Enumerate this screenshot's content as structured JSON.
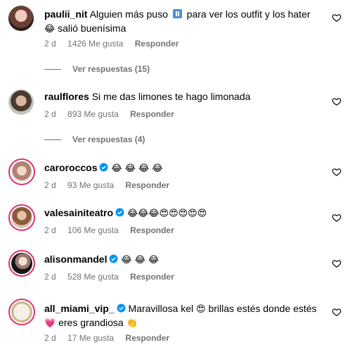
{
  "comments": [
    {
      "username": "paulii_nit",
      "text1": "Alguien más puso",
      "text1b": "para ver los outfit y los hater",
      "text2": "salió buenísima",
      "text2_emoji": "😂",
      "time": "2 d",
      "likes": "1426 Me gusta",
      "reply": "Responder",
      "view_replies": "Ver respuestas (15)"
    },
    {
      "username": "raulflores",
      "text1": "Si me das limones te hago limonada",
      "time": "2 d",
      "likes": "893 Me gusta",
      "reply": "Responder",
      "view_replies": "Ver respuestas (4)"
    },
    {
      "username": "caroroccos",
      "verified": true,
      "text1": "😂 😂 😂 😂",
      "time": "2 d",
      "likes": "93 Me gusta",
      "reply": "Responder"
    },
    {
      "username": "valesainiteatro",
      "verified": true,
      "text1": "😂😂😂😍😍😍😍😍",
      "time": "2 d",
      "likes": "106 Me gusta",
      "reply": "Responder"
    },
    {
      "username": "alisonmandel",
      "verified": true,
      "text1": "😂 😂 😂",
      "time": "2 d",
      "likes": "528 Me gusta",
      "reply": "Responder"
    },
    {
      "username": "all_miami_vip_",
      "verified": true,
      "text1": "Maravillosa kel",
      "text1_emoji": "😍",
      "text1b": "brillas estés donde estés",
      "text2_emoji": "💗",
      "text2": "eres grandiosa",
      "text2_emoji_end": "👏",
      "time": "2 d",
      "likes": "17 Me gusta",
      "reply": "Responder"
    }
  ],
  "colors": {
    "meta_text": "#737373",
    "verified_badge": "#0095f6",
    "story_ring": "#e1306c"
  }
}
